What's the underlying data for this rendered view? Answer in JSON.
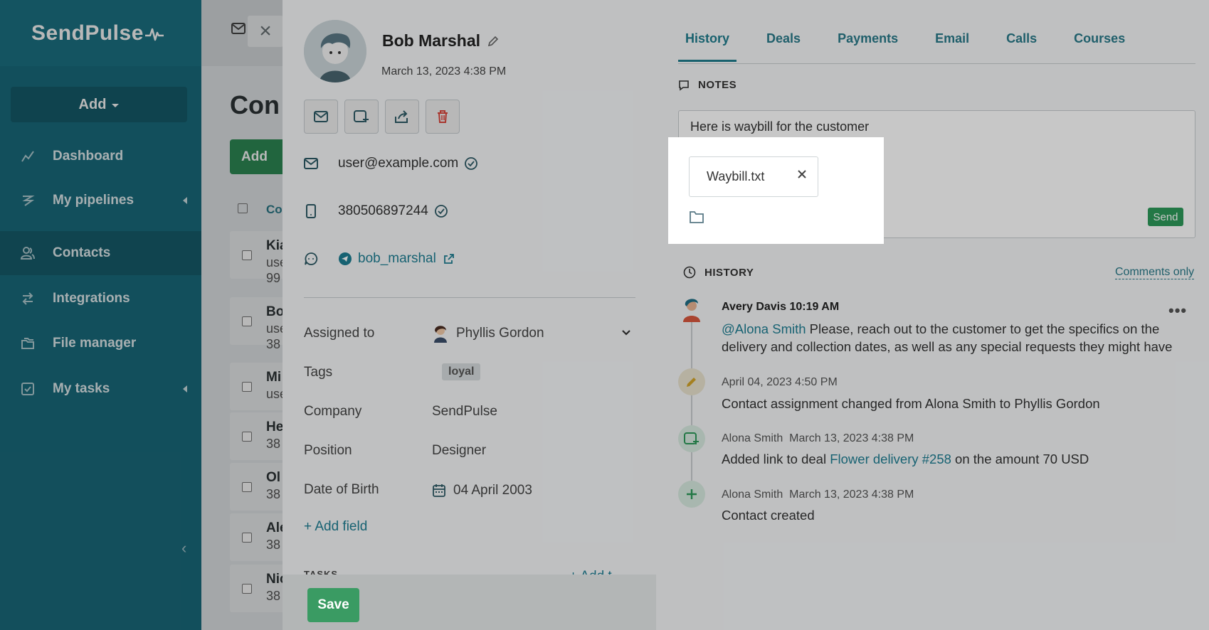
{
  "sidebar": {
    "logo": "SendPulse",
    "add_label": "Add",
    "items": [
      {
        "label": "Dashboard"
      },
      {
        "label": "My pipelines"
      },
      {
        "label": "Contacts"
      },
      {
        "label": "Integrations"
      },
      {
        "label": "File manager"
      },
      {
        "label": "My tasks"
      }
    ]
  },
  "background": {
    "title": "Con",
    "add_button": "Add",
    "column_head": "Co",
    "rows": [
      {
        "name": "Kia",
        "line1": "use",
        "line2": "99"
      },
      {
        "name": "Bo",
        "line1": "use",
        "line2": "38"
      },
      {
        "name": "Mi",
        "line1": "use",
        "line2": ""
      },
      {
        "name": "He",
        "line1": "38",
        "line2": ""
      },
      {
        "name": "Ol",
        "line1": "38",
        "line2": ""
      },
      {
        "name": "Ale",
        "line1": "38",
        "line2": ""
      },
      {
        "name": "Nic",
        "line1": "38",
        "line2": ""
      }
    ]
  },
  "contact": {
    "name": "Bob Marshal",
    "created": "March 13, 2023 4:38 PM",
    "email": "user@example.com",
    "phone": "380506897244",
    "telegram": "bob_marshal",
    "fields": {
      "assigned_label": "Assigned to",
      "assigned_value": "Phyllis Gordon",
      "tags_label": "Tags",
      "tag": "loyal",
      "company_label": "Company",
      "company_value": "SendPulse",
      "position_label": "Position",
      "position_value": "Designer",
      "dob_label": "Date of Birth",
      "dob_value": "04 April 2003"
    },
    "add_field": "+ Add field",
    "tasks_peek": "TASKS",
    "add_task_peek": "+ Add t",
    "save": "Save"
  },
  "tabs": [
    {
      "label": "History"
    },
    {
      "label": "Deals"
    },
    {
      "label": "Payments"
    },
    {
      "label": "Email"
    },
    {
      "label": "Calls"
    },
    {
      "label": "Courses"
    }
  ],
  "notes": {
    "heading": "NOTES",
    "text": "Here is waybill for the customer",
    "attachment": "Waybill.txt",
    "send": "Send"
  },
  "history": {
    "heading": "HISTORY",
    "filter": "Comments only",
    "entries": [
      {
        "author": "Avery Davis",
        "time": "10:19 AM",
        "mention": "@Alona Smith",
        "text": " Please, reach out to the customer to get the specifics on the delivery and collection dates, as well as any special requests they might have"
      },
      {
        "time": "April 04, 2023 4:50 PM",
        "text": "Contact assignment changed from Alona Smith to Phyllis Gordon"
      },
      {
        "author": "Alona Smith",
        "time": "March 13, 2023 4:38 PM",
        "text_before": "Added link to deal ",
        "link": "Flower delivery #258",
        "text_after": " on the amount 70 USD"
      },
      {
        "author": "Alona Smith",
        "time": "March 13, 2023 4:38 PM",
        "text": "Contact created"
      }
    ]
  },
  "colors": {
    "sidebar": "#1a6e80",
    "accent": "#1f7d8e",
    "success": "#2e9a5a",
    "danger": "#d9463b"
  }
}
